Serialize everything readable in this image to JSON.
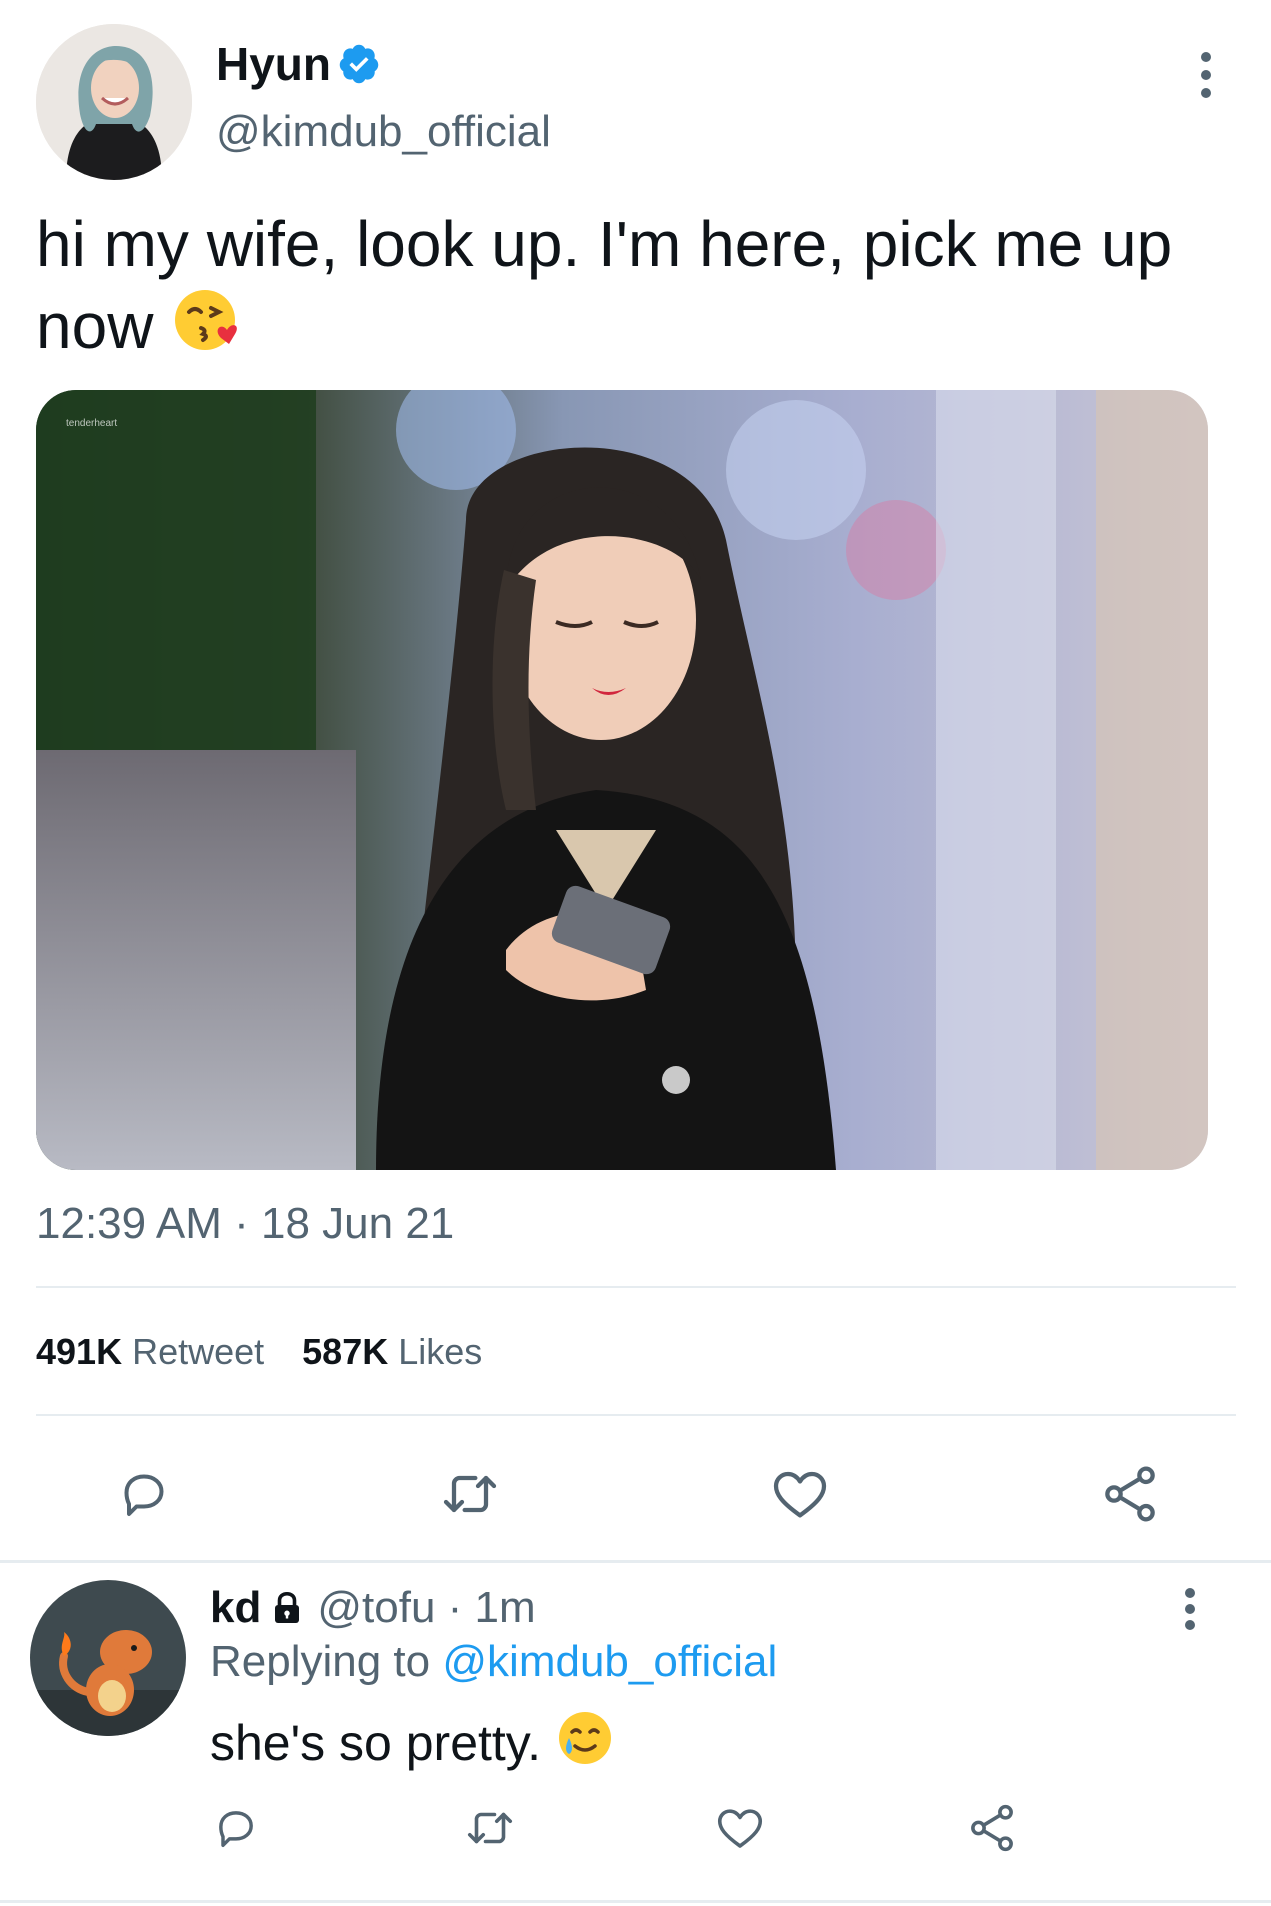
{
  "tweet": {
    "author": {
      "display_name": "Hyun",
      "handle": "@kimdub_official",
      "verified": true
    },
    "text": "hi my wife, look up. I'm here, pick me up now",
    "emoji": "face-blowing-a-kiss",
    "media": {
      "watermark": "tenderheart"
    },
    "timestamp": "12:39 AM · 18 Jun 21",
    "stats": {
      "retweets_count": "491K",
      "retweets_label": "Retweet",
      "likes_count": "587K",
      "likes_label": "Likes"
    },
    "actions": [
      "reply-icon",
      "retweet-icon",
      "like-icon",
      "share-icon"
    ]
  },
  "reply": {
    "display_name": "kd",
    "protected": true,
    "handle_time": "@tofu · 1m",
    "replying_prefix": "Replying to",
    "replying_handle": "@kimdub_official",
    "text": "she's so pretty.",
    "emoji": "smiling-face-with-tear",
    "actions": [
      "reply-icon",
      "retweet-icon",
      "like-icon",
      "share-icon"
    ]
  },
  "colors": {
    "text_primary": "#0f1419",
    "text_secondary": "#536471",
    "accent": "#1d9bf0",
    "divider": "#e6ecf0"
  }
}
